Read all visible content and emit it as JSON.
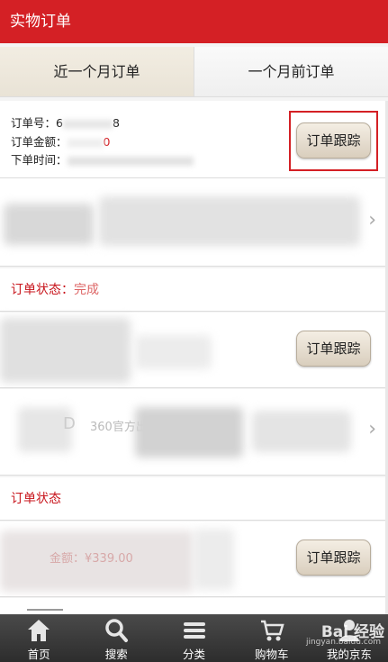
{
  "header": {
    "title": "实物订单"
  },
  "tabs": [
    {
      "label": "近一个月订单",
      "active": true
    },
    {
      "label": "一个月前订单",
      "active": false
    }
  ],
  "order1": {
    "number_label": "订单号：6",
    "number_suffix": "8",
    "amount_label": "订单金额：",
    "amount_suffix": "0",
    "time_label": "下单时间：",
    "track_button": "订单跟踪"
  },
  "status1": {
    "label": "订单状态：",
    "value": "完成"
  },
  "order2": {
    "track_button": "订单跟踪",
    "product_text": "360官方出品 ... 设置同",
    "product_initial": "D"
  },
  "status2": {
    "label": "订单状态"
  },
  "order3": {
    "amount_text": "金额：¥339.00",
    "track_button": "订单跟踪"
  },
  "nav": [
    {
      "label": "首页",
      "icon": "home-icon"
    },
    {
      "label": "搜索",
      "icon": "search-icon"
    },
    {
      "label": "分类",
      "icon": "menu-icon"
    },
    {
      "label": "购物车",
      "icon": "cart-icon"
    },
    {
      "label": "我的京东",
      "icon": "user-icon"
    }
  ],
  "watermark": {
    "main": "Bai 经验",
    "sub": "jingyan.baidu.com"
  },
  "colors": {
    "brand": "#d42025",
    "status": "#c8161d",
    "nav_bg": "#2d2d2d"
  }
}
